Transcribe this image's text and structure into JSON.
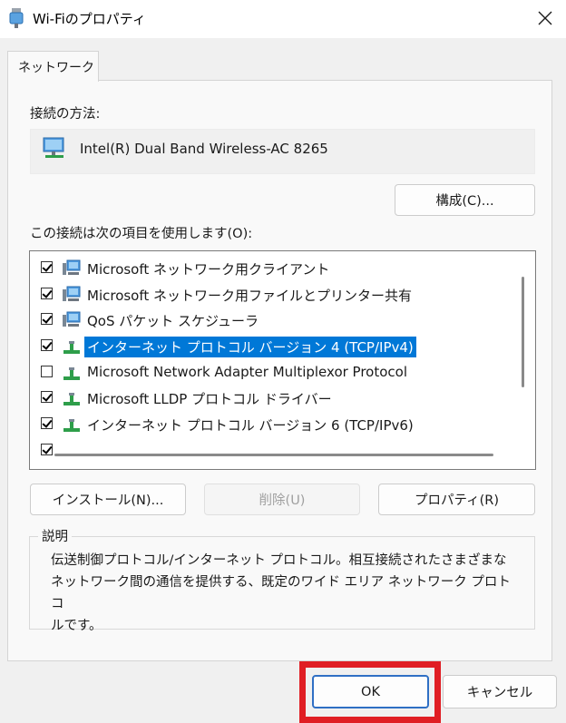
{
  "window": {
    "title": "Wi-Fiのプロパティ",
    "close_glyph": "✕"
  },
  "tabs": [
    {
      "label": "ネットワーク"
    }
  ],
  "connect_using_label": "接続の方法:",
  "adapter": {
    "name": "Intel(R) Dual Band Wireless-AC 8265",
    "icon": "network-adapter-icon"
  },
  "configure_button": "構成(C)...",
  "items_label": "この接続は次の項目を使用します(O):",
  "items": [
    {
      "label": "Microsoft ネットワーク用クライアント",
      "checked": true,
      "icon": "network-client-icon",
      "selected": false
    },
    {
      "label": "Microsoft ネットワーク用ファイルとプリンター共有",
      "checked": true,
      "icon": "network-share-icon",
      "selected": false
    },
    {
      "label": "QoS パケット スケジューラ",
      "checked": true,
      "icon": "network-service-icon",
      "selected": false
    },
    {
      "label": "インターネット プロトコル バージョン 4 (TCP/IPv4)",
      "checked": true,
      "icon": "protocol-icon",
      "selected": true
    },
    {
      "label": "Microsoft Network Adapter Multiplexor Protocol",
      "checked": false,
      "icon": "protocol-icon",
      "selected": false
    },
    {
      "label": "Microsoft LLDP プロトコル ドライバー",
      "checked": true,
      "icon": "protocol-icon",
      "selected": false
    },
    {
      "label": "インターネット プロトコル バージョン 6 (TCP/IPv6)",
      "checked": true,
      "icon": "protocol-icon",
      "selected": false
    }
  ],
  "install_button": "インストール(N)...",
  "uninstall_button": "削除(U)",
  "properties_button": "プロパティ(R)",
  "description": {
    "legend": "説明",
    "lines": [
      "伝送制御プロトコル/インターネット プロトコル。相互接続されたさまざまな",
      "ネットワーク間の通信を提供する、既定のワイド エリア ネットワーク プロトコ",
      "ルです。"
    ]
  },
  "ok_button": "OK",
  "cancel_button": "キャンセル",
  "colors": {
    "selection": "#0078d7",
    "highlight_box": "#e01e24",
    "focus_border": "#2f6fc4"
  }
}
